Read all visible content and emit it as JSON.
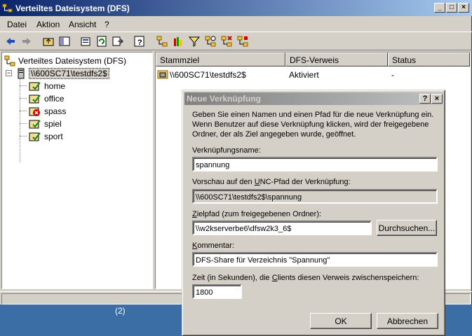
{
  "window": {
    "title": "Verteiltes Dateisystem (DFS)"
  },
  "menu": {
    "items": [
      "Datei",
      "Aktion",
      "Ansicht",
      "?"
    ]
  },
  "tree": {
    "root": "Verteiltes Dateisystem (DFS)",
    "server": "\\\\600SC71\\testdfs2$",
    "children": [
      "home",
      "office",
      "spass",
      "spiel",
      "sport"
    ]
  },
  "list": {
    "columns": [
      "Stammziel",
      "DFS-Verweis",
      "Status"
    ],
    "rows": [
      {
        "stammziel": "\\\\600SC71\\testdfs2$",
        "verweis": "Aktiviert",
        "status": "-"
      }
    ]
  },
  "taskbar": {
    "label": "(2)"
  },
  "dialog": {
    "title": "Neue Verknüpfung",
    "description": "Geben Sie einen Namen und einen Pfad für die neue Verknüpfung ein. Wenn Benutzer auf diese Verknüpfung klicken, wird der freigegebene Ordner, der als Ziel angegeben wurde, geöffnet.",
    "name_label": "Verknüpfungsname:",
    "name_value": "spannung",
    "preview_label_a": "Vorschau auf den ",
    "preview_label_u": "U",
    "preview_label_b": "NC-Pfad der Verknüpfung:",
    "preview_value": "\\\\600SC71\\testdfs2$\\spannung",
    "target_label_u": "Z",
    "target_label_b": "ielpfad (zum freigegebenen Ordner):",
    "target_value": "\\\\w2kserverbe6\\dfsw2k3_6$",
    "browse_label": "Durchsuchen...",
    "comment_label_u": "K",
    "comment_label_b": "ommentar:",
    "comment_value": "DFS-Share für Verzeichnis \"Spannung\"",
    "cache_label_a": "Zeit (in Sekunden), die ",
    "cache_label_u": "C",
    "cache_label_b": "lients diesen Verweis zwischenspeichern:",
    "cache_value": "1800",
    "ok_label": "OK",
    "cancel_label": "Abbrechen"
  }
}
